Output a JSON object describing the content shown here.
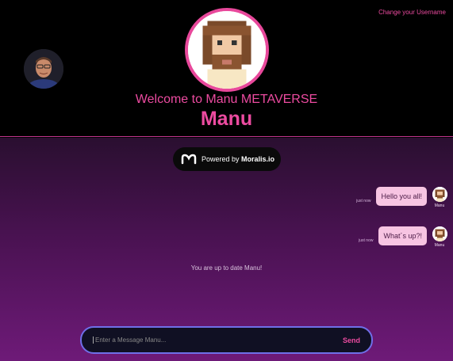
{
  "header": {
    "change_username_link": "Change your Username",
    "welcome_text": "Welcome to Manu METAVERSE",
    "username": "Manu"
  },
  "powered_badge": {
    "prefix": "Powered by",
    "brand": "Moralis.io"
  },
  "messages": [
    {
      "text": "Hello you all!",
      "time": "just now",
      "author": "Manu"
    },
    {
      "text": "What´s up?!",
      "time": "just now",
      "author": "Manu"
    }
  ],
  "status_text": "You are up to date Manu!",
  "composer": {
    "placeholder": "Enter a Message Manu...",
    "send_label": "Send"
  },
  "colors": {
    "accent": "#ec4ba0",
    "gradient_top": "#2a0f30",
    "gradient_bottom": "#6e1a78",
    "bubble": "#f7c4e2",
    "input_border": "#6f6fe8"
  }
}
